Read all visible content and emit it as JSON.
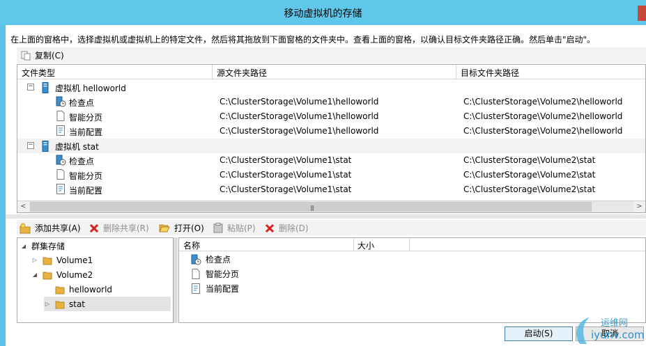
{
  "window": {
    "title": "移动虚拟机的存储"
  },
  "instruction": "在上面的窗格中，选择虚拟机或虚拟机上的特定文件，然后将其拖放到下面窗格的文件夹中。查看上面的窗格，以确认目标文件夹路径正确。然后单击\"启动\"。",
  "top_toolbar": {
    "copy_label": "复制(C)"
  },
  "grid": {
    "columns": [
      "文件类型",
      "源文件夹路径",
      "目标文件夹路径"
    ],
    "groups": [
      {
        "name": "虚拟机 helloworld",
        "items": [
          {
            "type": "检查点",
            "icon": "checkpoint-icon",
            "source": "C:\\ClusterStorage\\Volume1\\helloworld",
            "target": "C:\\ClusterStorage\\Volume2\\helloworld"
          },
          {
            "type": "智能分页",
            "icon": "document-icon",
            "source": "C:\\ClusterStorage\\Volume1\\helloworld",
            "target": "C:\\ClusterStorage\\Volume2\\helloworld"
          },
          {
            "type": "当前配置",
            "icon": "config-icon",
            "source": "C:\\ClusterStorage\\Volume1\\helloworld",
            "target": "C:\\ClusterStorage\\Volume2\\helloworld"
          }
        ]
      },
      {
        "name": "虚拟机 stat",
        "items": [
          {
            "type": "检查点",
            "icon": "checkpoint-icon",
            "source": "C:\\ClusterStorage\\Volume1\\stat",
            "target": "C:\\ClusterStorage\\Volume2\\stat"
          },
          {
            "type": "智能分页",
            "icon": "document-icon",
            "source": "C:\\ClusterStorage\\Volume1\\stat",
            "target": "C:\\ClusterStorage\\Volume2\\stat"
          },
          {
            "type": "当前配置",
            "icon": "config-icon",
            "source": "C:\\ClusterStorage\\Volume1\\stat",
            "target": "C:\\ClusterStorage\\Volume2\\stat"
          }
        ]
      }
    ]
  },
  "bottom_toolbar": {
    "add_share": "添加共享(A)",
    "remove_share": "删除共享(R)",
    "open": "打开(O)",
    "paste": "粘贴(P)",
    "delete": "删除(D)"
  },
  "tree": {
    "root": "群集存储",
    "nodes": [
      "Volume1",
      "Volume2",
      "helloworld",
      "stat"
    ]
  },
  "files": {
    "columns": [
      "名称",
      "大小"
    ],
    "items": [
      "检查点",
      "智能分页",
      "当前配置"
    ]
  },
  "buttons": {
    "start": "启动(S)",
    "cancel": "取消"
  },
  "watermark": {
    "text1": "运维网",
    "text2": "iyunv.com"
  },
  "colors": {
    "titlebar": "#5ec7ea",
    "close": "#c7473b",
    "delete_red": "#d9201e",
    "folder": "#e8b33d"
  }
}
